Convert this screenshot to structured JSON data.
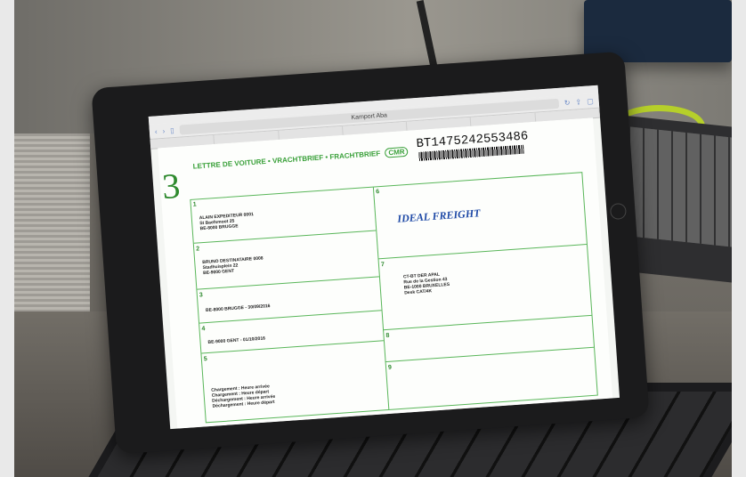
{
  "browser": {
    "title": "Kamport Aba",
    "tabs": [
      "",
      "",
      "",
      "",
      "",
      "",
      ""
    ]
  },
  "document": {
    "form_number": "3",
    "title": "LETTRE DE VOITURE • VRACHTBRIEF • FRACHTBRIEF",
    "cmr_badge": "CMR",
    "reference": "BT1475242553486",
    "sender": "ALAIN EXPEDITEUR 0001\nSt Baefsmoot 25\nBE-8000 BRUGGE",
    "consignee": "BRUNO DESTINATAIRE 0008\nStadhuisplein 22\nBE-9000 GENT",
    "loading": "BE-8000 BRUGGE - 30/09/2016",
    "delivery": "BE-9000 GENT - 01/10/2016",
    "carrier_logo": "IDEAL FREIGHT",
    "carrier_address": "CT-BT DER APAL\nRue de la Gestion 43\nBE-1000 BRUXELLES\nDesk CAT/4K",
    "timings": "Chargement : Heure arrivée\nChargement : Heure départ\nDéchargement : Heure arrivée\nDéchargement : Heure départ"
  }
}
